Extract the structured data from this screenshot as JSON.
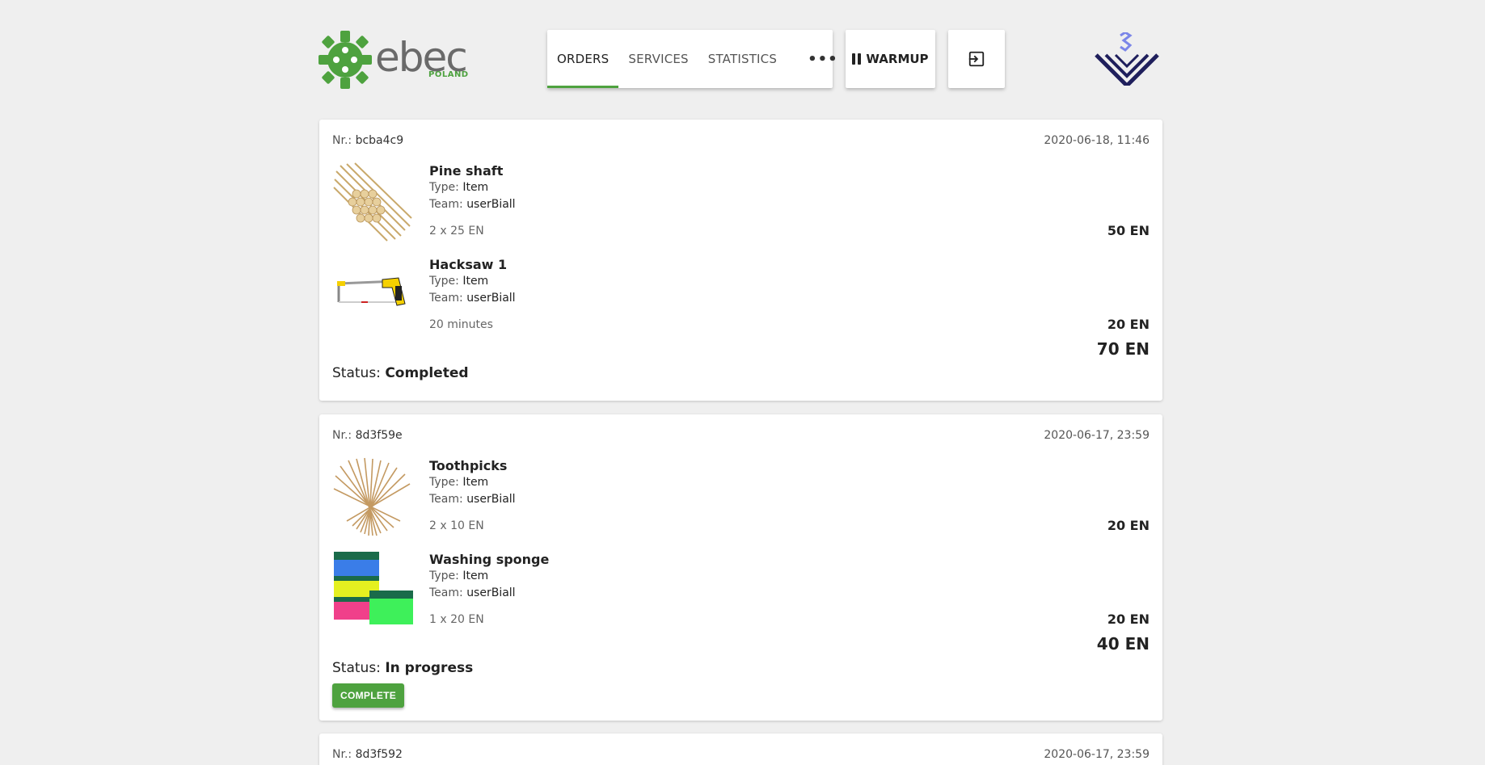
{
  "brand": {
    "name": "ebec",
    "region": "POLAND"
  },
  "nav": {
    "tabs": [
      {
        "label": "ORDERS",
        "active": true
      },
      {
        "label": "SERVICES",
        "active": false
      },
      {
        "label": "STATISTICS",
        "active": false
      }
    ],
    "more_label": "•••",
    "warmup_label": "WARMUP"
  },
  "labels": {
    "nr": "Nr.:",
    "type": "Type:",
    "team": "Team:",
    "status": "Status:"
  },
  "orders": [
    {
      "nr": "bcba4c9",
      "date": "2020-06-18, 11:46",
      "items": [
        {
          "name": "Pine shaft",
          "type": "Item",
          "team": "userBiall",
          "qty": "2 x 25 EN",
          "price": "50 EN",
          "image": "pine-shaft"
        },
        {
          "name": "Hacksaw 1",
          "type": "Item",
          "team": "userBiall",
          "qty": "20 minutes",
          "price": "20 EN",
          "image": "hacksaw"
        }
      ],
      "total": "70 EN",
      "status": "Completed"
    },
    {
      "nr": "8d3f59e",
      "date": "2020-06-17, 23:59",
      "items": [
        {
          "name": "Toothpicks",
          "type": "Item",
          "team": "userBiall",
          "qty": "2 x 10 EN",
          "price": "20 EN",
          "image": "toothpicks"
        },
        {
          "name": "Washing sponge",
          "type": "Item",
          "team": "userBiall",
          "qty": "1 x 20 EN",
          "price": "20 EN",
          "image": "washing-sponge"
        }
      ],
      "total": "40 EN",
      "status": "In progress",
      "action_label": "COMPLETE"
    },
    {
      "nr": "8d3f592",
      "date": "2020-06-17, 23:59"
    }
  ],
  "colors": {
    "accent": "#4ea23f",
    "background": "#efefef",
    "card": "#ffffff",
    "partner": "#1f1f5c"
  }
}
